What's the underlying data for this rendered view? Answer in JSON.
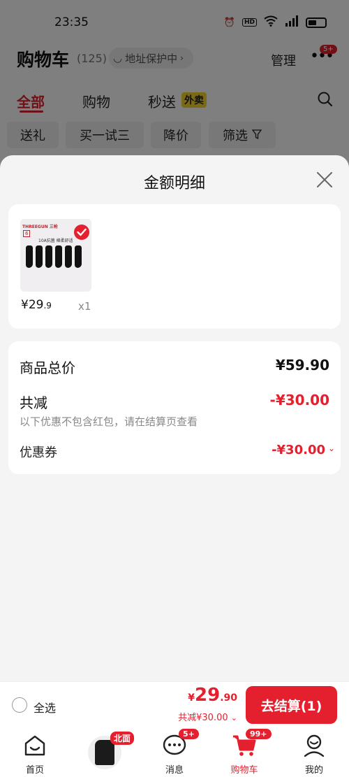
{
  "status_bar": {
    "time": "23:35",
    "hd": "HD",
    "network": "5G"
  },
  "header": {
    "title": "购物车",
    "count": "(125)",
    "address_label": "地址保护中",
    "manage_label": "管理",
    "more_badge": "5+"
  },
  "tabs": [
    {
      "label": "全部"
    },
    {
      "label": "购物"
    },
    {
      "label": "秒送"
    }
  ],
  "waimai_badge": "外卖",
  "filters": [
    {
      "label": "送礼"
    },
    {
      "label": "买一试三"
    },
    {
      "label": "降价"
    },
    {
      "label": "筛选"
    }
  ],
  "sheet": {
    "title": "金额明细",
    "goods": {
      "brand": "THREEGUN 三枪",
      "pack_count": "6",
      "line": "10A抗菌 棉柔舒适",
      "price_main": "¥29",
      "price_decimal": ".9",
      "qty": "x1"
    },
    "total_label": "商品总价",
    "total_value": "¥59.90",
    "reduce_label": "共减",
    "reduce_value": "-¥30.00",
    "note": "以下优惠不包含红包，请在结算页查看",
    "coupon_label": "优惠券",
    "coupon_value": "-¥30.00"
  },
  "checkout": {
    "select_all_label": "全选",
    "price_currency": "¥",
    "price_int": "29",
    "price_dec": ".90",
    "saving": "共减¥30.00",
    "button_label": "去结算(1)"
  },
  "tab_bar": {
    "promo_tag": "北面",
    "items": [
      {
        "label": "首页",
        "badge": ""
      },
      {
        "label": "消息",
        "badge": "5+"
      },
      {
        "label": "购物车",
        "badge": "99+"
      },
      {
        "label": "我的",
        "badge": ""
      }
    ]
  },
  "colors": {
    "accent": "#e4202e",
    "sheet_bg": "#f4f4f4"
  }
}
